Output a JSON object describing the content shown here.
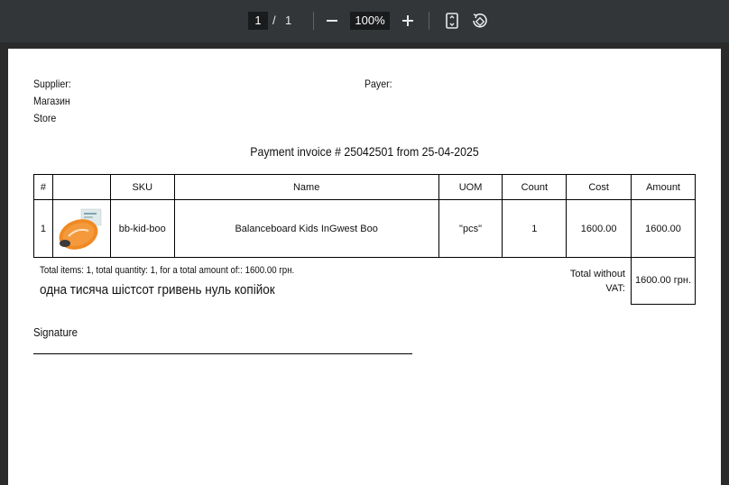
{
  "toolbar": {
    "page_current": "1",
    "page_separator": "/",
    "page_total": "1",
    "zoom": "100%",
    "zoom_out_icon": "minus-icon",
    "zoom_in_icon": "plus-icon",
    "fit_icon": "fit-page-icon",
    "rotate_icon": "rotate-icon"
  },
  "invoice": {
    "supplier_label": "Supplier:",
    "supplier_name_1": "Магазин",
    "supplier_name_2": "Store",
    "payer_label": "Payer:",
    "title": "Payment invoice # 25042501 from 25-04-2025",
    "columns": [
      "#",
      "",
      "SKU",
      "Name",
      "UOM",
      "Count",
      "Cost",
      "Amount"
    ],
    "rows": [
      {
        "num": "1",
        "sku": "bb-kid-boo",
        "name": "Balanceboard Kids InGwest Boo",
        "uom": "\"pcs\"",
        "count": "1",
        "cost": "1600.00",
        "amount": "1600.00"
      }
    ],
    "summary": "Total items: 1, total quantity: 1, for a total amount of:: 1600.00 грн.",
    "amount_words": "одна тисяча шістсот гривень нуль копійок",
    "total_label_1": "Total without",
    "total_label_2": "VAT:",
    "total_value": "1600.00 грн.",
    "signature_label": "Signature"
  },
  "colors": {
    "toolbar_bg": "#323639",
    "viewer_bg": "#2b2b2b",
    "board_orange": "#f08a24"
  }
}
